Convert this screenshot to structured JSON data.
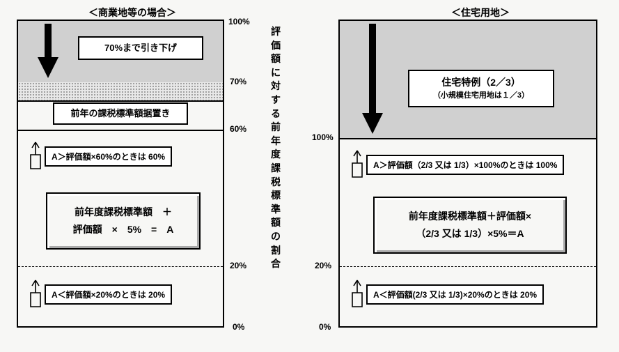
{
  "center_label": "評価額に対する前年度課税標準額の割合",
  "left": {
    "title": "＜商業地等の場合＞",
    "pct": {
      "p100": "100%",
      "p70": "70%",
      "p60": "60%",
      "p20": "20%",
      "p0": "0%"
    },
    "box_top": "70%まで引き下げ",
    "box_mid": "前年の課税標準額据置き",
    "rule_upper": "A＞評価額×60%のときは 60%",
    "formula_line1": "前年度課税標準額　＋",
    "formula_line2": "評価額　×　5%　=　A",
    "rule_lower": "A＜評価額×20%のときは 20%"
  },
  "right": {
    "title": "＜住宅用地＞",
    "pct": {
      "p100": "100%",
      "p20": "20%",
      "p0": "0%"
    },
    "box_top_line1": "住宅特例（2／3）",
    "box_top_line2": "（小規模住宅用地は１／3）",
    "rule_upper": "A＞評価額（2/3 又は 1/3）×100%のときは 100%",
    "formula_line1": "前年度課税標準額＋評価額×",
    "formula_line2": "（2/3 又は 1/3）×5%＝A",
    "rule_lower": "A＜評価額(2/3 又は 1/3)×20%のときは 20%"
  }
}
